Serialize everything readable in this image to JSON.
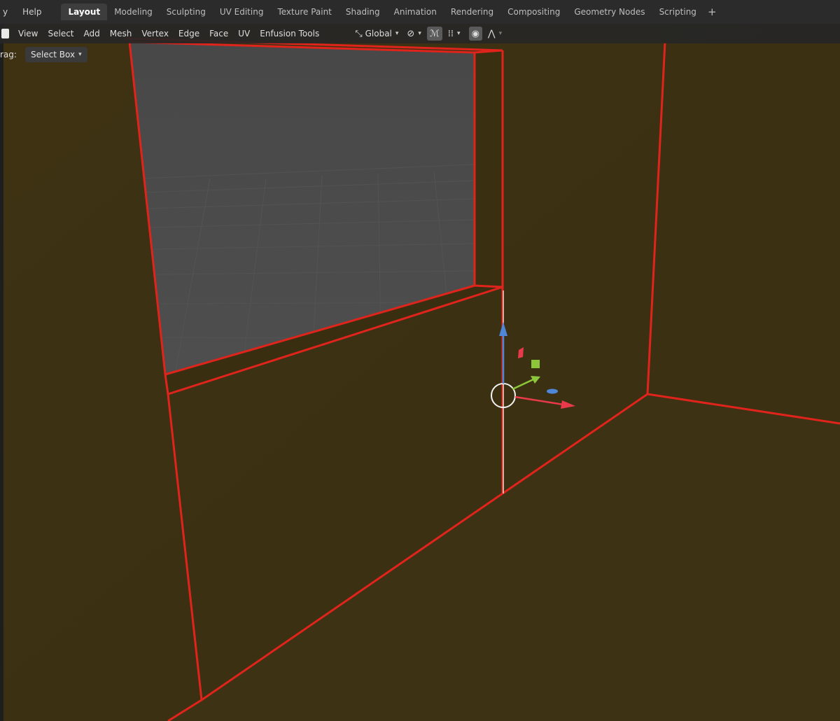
{
  "topbar": {
    "menu": [
      {
        "label": "y"
      },
      {
        "label": "Help"
      }
    ],
    "workspace_tabs": [
      {
        "label": "Layout",
        "active": true
      },
      {
        "label": "Modeling"
      },
      {
        "label": "Sculpting"
      },
      {
        "label": "UV Editing"
      },
      {
        "label": "Texture Paint"
      },
      {
        "label": "Shading"
      },
      {
        "label": "Animation"
      },
      {
        "label": "Rendering"
      },
      {
        "label": "Compositing"
      },
      {
        "label": "Geometry Nodes"
      },
      {
        "label": "Scripting"
      }
    ],
    "add_tab_label": "+"
  },
  "viewport_header": {
    "menus": [
      "View",
      "Select",
      "Add",
      "Mesh",
      "Vertex",
      "Edge",
      "Face",
      "UV",
      "Enfusion Tools"
    ],
    "transform_orientation": "Global"
  },
  "tool_settings": {
    "drag_label": "rag:",
    "drag_value": "Select Box"
  },
  "colors": {
    "wall": "#3c3112",
    "edge_select": "#e0241c",
    "grid_bg": "#4b4b4b",
    "axis_x": "#e83a4a",
    "axis_y": "#8cc63a",
    "axis_z": "#4f86d8"
  },
  "icons": {
    "orientation": "transform-orientation-icon",
    "pivot": "pivot-icon",
    "snap": "magnet-icon",
    "snap_target": "snap-target-icon",
    "proportional": "proportional-edit-icon",
    "falloff": "falloff-curve-icon"
  }
}
